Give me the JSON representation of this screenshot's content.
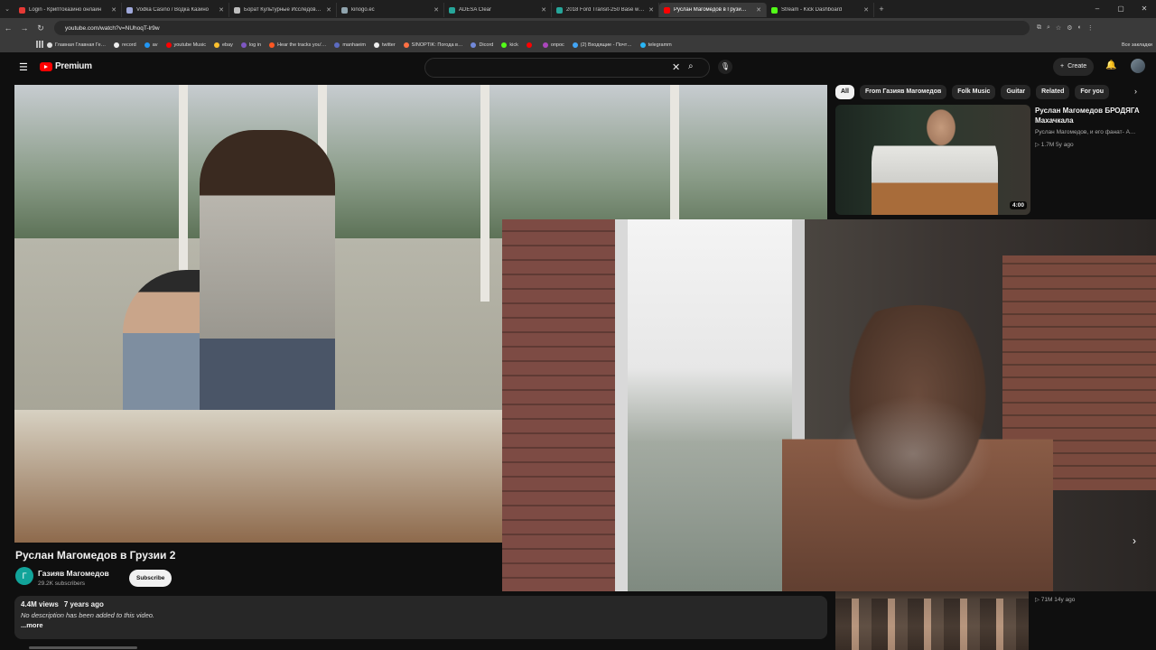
{
  "browser": {
    "tabs": [
      {
        "title": "Login - Криптоказино онлайн",
        "color": "#e53935"
      },
      {
        "title": "Vodka Casino / Водка Казино",
        "color": "#9fa8da"
      },
      {
        "title": "Борат Культурные Исследования",
        "color": "#bdbdbd"
      },
      {
        "title": "kinogo.ec",
        "color": "#90a4ae"
      },
      {
        "title": "ADESA Clear",
        "color": "#26a69a"
      },
      {
        "title": "2018 Ford Transit-250 Base w/…",
        "color": "#26a69a"
      },
      {
        "title": "Руслан Магомедов в Грузи…",
        "color": "#ff0000"
      },
      {
        "title": "Stream - Kick Dashboard",
        "color": "#53fc18"
      }
    ],
    "active_tab": 6,
    "url": "youtube.com/watch?v=NUhoqT-lr9w",
    "bookmarks": [
      {
        "label": "Главная Главная Ге…",
        "color": "#e0e0e0"
      },
      {
        "label": "record",
        "color": "#eeeeee"
      },
      {
        "label": "av",
        "color": "#2196f3"
      },
      {
        "label": "youtube Music",
        "color": "#ff0000"
      },
      {
        "label": "ebay",
        "color": "#fbc02d"
      },
      {
        "label": "log in",
        "color": "#7e57c2"
      },
      {
        "label": "Hear the tracks you'…",
        "color": "#ff5722"
      },
      {
        "label": "manhaeim",
        "color": "#5c6bc0"
      },
      {
        "label": "twitter",
        "color": "#eeeeee"
      },
      {
        "label": "SINOPTIK: Погода в…",
        "color": "#ff7043"
      },
      {
        "label": "Dicord",
        "color": "#7289da"
      },
      {
        "label": "kick",
        "color": "#53fc18"
      },
      {
        "label": "",
        "color": "#ff0000"
      },
      {
        "label": "опрос",
        "color": "#ab47bc"
      },
      {
        "label": "(2) Входящие - Почт…",
        "color": "#42a5f5"
      },
      {
        "label": "telegramm",
        "color": "#29b6f6"
      }
    ],
    "all_bookmarks": "Все закладки"
  },
  "youtube": {
    "logo_text": "Premium",
    "search_value": "",
    "create_label": "Create"
  },
  "video": {
    "title": "Руслан Магомедов в Грузии 2",
    "channel_initial": "Г",
    "channel_name": "Газияв Магомедов",
    "subscribers": "29.2K subscribers",
    "subscribe_label": "Subscribe",
    "views": "4.4M views",
    "age": "7 years ago",
    "description": "No description has been added to this video.",
    "more_label": "...more"
  },
  "sidebar": {
    "chips": [
      "All",
      "From Газияв Магомедов",
      "Folk Music",
      "Guitar",
      "Related",
      "For you"
    ],
    "selected_chip": 0,
    "recommendations": [
      {
        "title": "Руслан Магомедов БРОДЯГА Махачкала",
        "channel": "Руслан Магомедов, и его фанат- А…",
        "stats": "▷ 1.7M  5y ago",
        "duration": "4:00"
      },
      {
        "title": "",
        "channel": "",
        "stats": "▷ 71M  14y ago",
        "duration": ""
      }
    ]
  }
}
